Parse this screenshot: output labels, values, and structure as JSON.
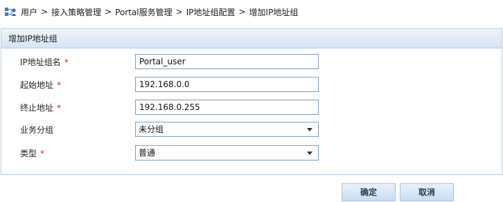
{
  "breadcrumb": {
    "items": [
      "用户",
      "接入策略管理",
      "Portal服务管理",
      "IP地址组配置",
      "增加IP地址组"
    ],
    "separator": ">"
  },
  "panel": {
    "title": "增加IP地址组"
  },
  "form": {
    "group_name": {
      "label": "IP地址组名",
      "required_mark": "*",
      "value": "Portal_user"
    },
    "start_address": {
      "label": "起始地址",
      "required_mark": "*",
      "value": "192.168.0.0"
    },
    "end_address": {
      "label": "终止地址",
      "required_mark": "*",
      "value": "192.168.0.255"
    },
    "business_group": {
      "label": "业务分组",
      "selected": "未分组"
    },
    "type": {
      "label": "类型",
      "required_mark": "*",
      "selected": "普通"
    }
  },
  "actions": {
    "confirm_label": "确定",
    "cancel_label": "取消"
  },
  "colors": {
    "panel_border": "#b9cde4",
    "header_bg": "#d7e4f3",
    "required": "#e02020",
    "field_border": "#7f9db9"
  },
  "icons": {
    "breadcrumb_icon": "user-network-icon",
    "select_arrow": "chevron-down-icon"
  }
}
